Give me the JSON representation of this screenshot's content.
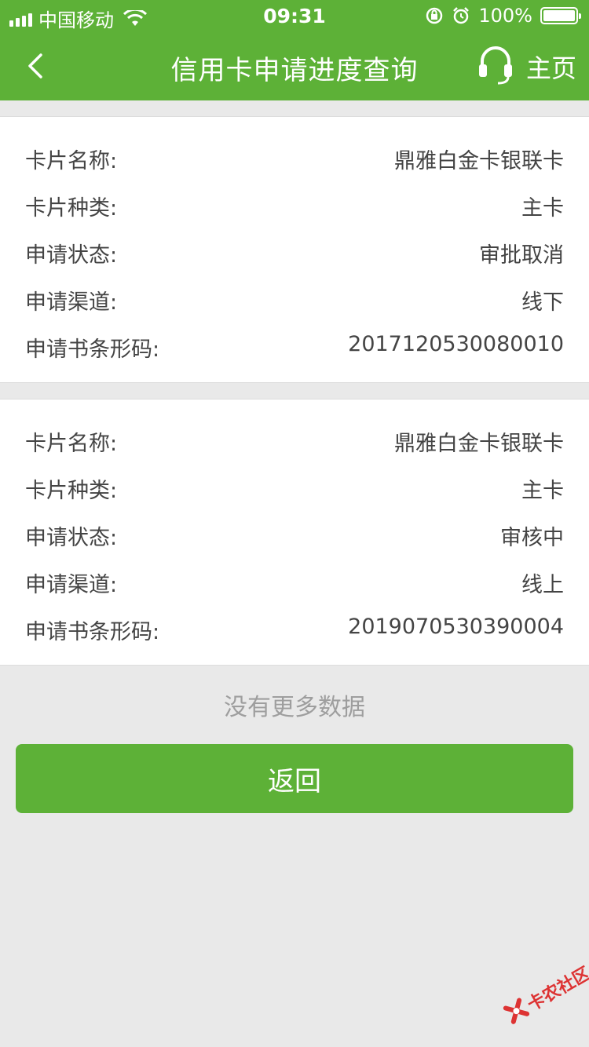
{
  "status_bar": {
    "carrier": "中国移动",
    "time": "09:31",
    "battery": "100%",
    "battery_level": 1.0,
    "icons": [
      "signal-icon",
      "wifi-icon",
      "rotation-lock-icon",
      "alarm-icon",
      "battery-icon"
    ]
  },
  "header": {
    "title": "信用卡申请进度查询",
    "home_label": "主页",
    "icons": [
      "back-chevron-icon",
      "headset-icon"
    ]
  },
  "applications": [
    {
      "fields": [
        {
          "label": "卡片名称:",
          "value": "鼎雅白金卡银联卡"
        },
        {
          "label": "卡片种类:",
          "value": "主卡"
        },
        {
          "label": "申请状态:",
          "value": "审批取消"
        },
        {
          "label": "申请渠道:",
          "value": "线下"
        },
        {
          "label": "申请书条形码:",
          "value": "2017120530080010"
        }
      ]
    },
    {
      "fields": [
        {
          "label": "卡片名称:",
          "value": "鼎雅白金卡银联卡"
        },
        {
          "label": "卡片种类:",
          "value": "主卡"
        },
        {
          "label": "申请状态:",
          "value": "审核中"
        },
        {
          "label": "申请渠道:",
          "value": "线上"
        },
        {
          "label": "申请书条形码:",
          "value": "2019070530390004"
        }
      ]
    }
  ],
  "footer": {
    "no_more": "没有更多数据",
    "back_button": "返回"
  },
  "watermark": {
    "text": "卡农社区"
  },
  "colors": {
    "primary_green": "#5db137",
    "background": "#e9e9e9",
    "card": "#ffffff",
    "label_text": "#444444",
    "muted_text": "#9e9e9e"
  }
}
